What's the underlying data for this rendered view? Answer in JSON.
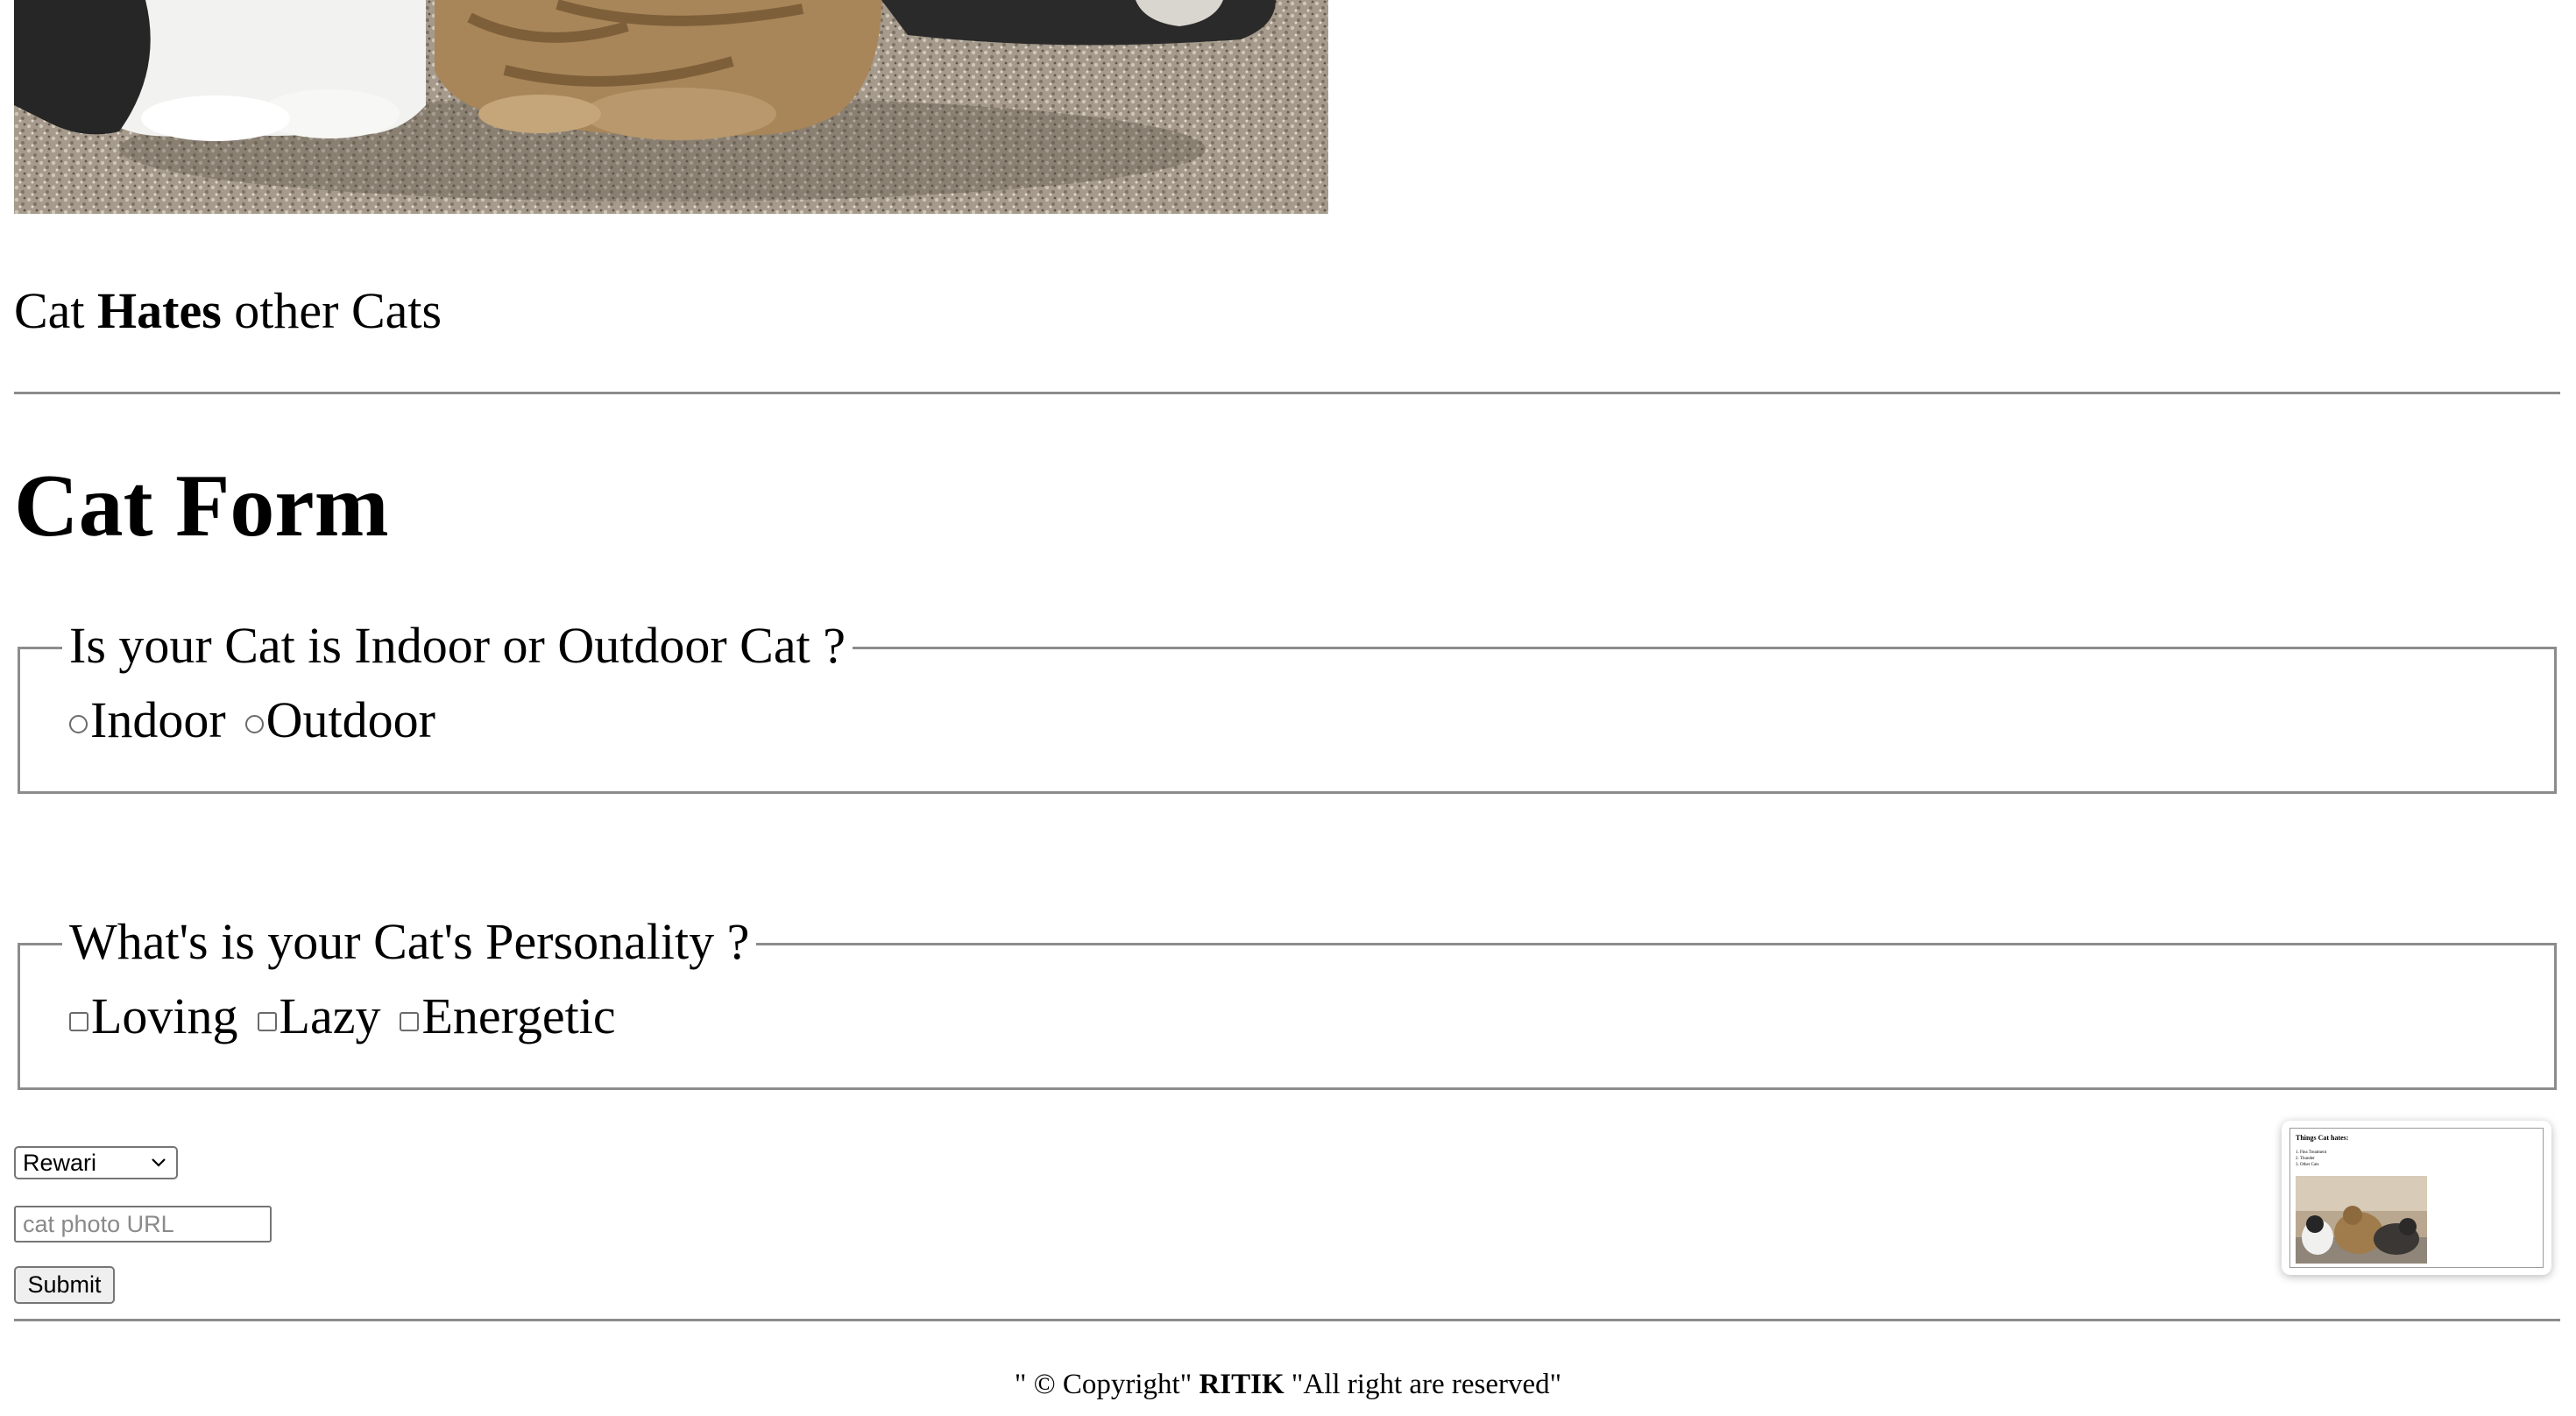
{
  "main": {
    "hates": {
      "prefix": "Cat ",
      "bold": "Hates",
      "suffix": " other Cats"
    }
  },
  "form": {
    "title": "Cat Form",
    "location": {
      "legend": "Is your Cat is Indoor or Outdoor Cat ?",
      "options": [
        "Indoor",
        "Outdoor"
      ]
    },
    "personality": {
      "legend": "What's is your Cat's Personality ?",
      "options": [
        "Loving",
        "Lazy",
        "Energetic"
      ]
    },
    "city_select": {
      "selected": "Rewari"
    },
    "url_input": {
      "placeholder": "cat photo URL",
      "value": ""
    },
    "submit_label": "Submit"
  },
  "footer": {
    "prefix": "\" © Copyright\" ",
    "bold": "RITIK",
    "suffix": " \"All right are reserved\""
  },
  "thumbnail": {
    "title": "Things Cat hates:",
    "items": [
      "1. Flea Treatment",
      "2. Thunder",
      "3. Other Cats"
    ]
  },
  "icons": {
    "select_chevron": "chevron-down-icon"
  }
}
